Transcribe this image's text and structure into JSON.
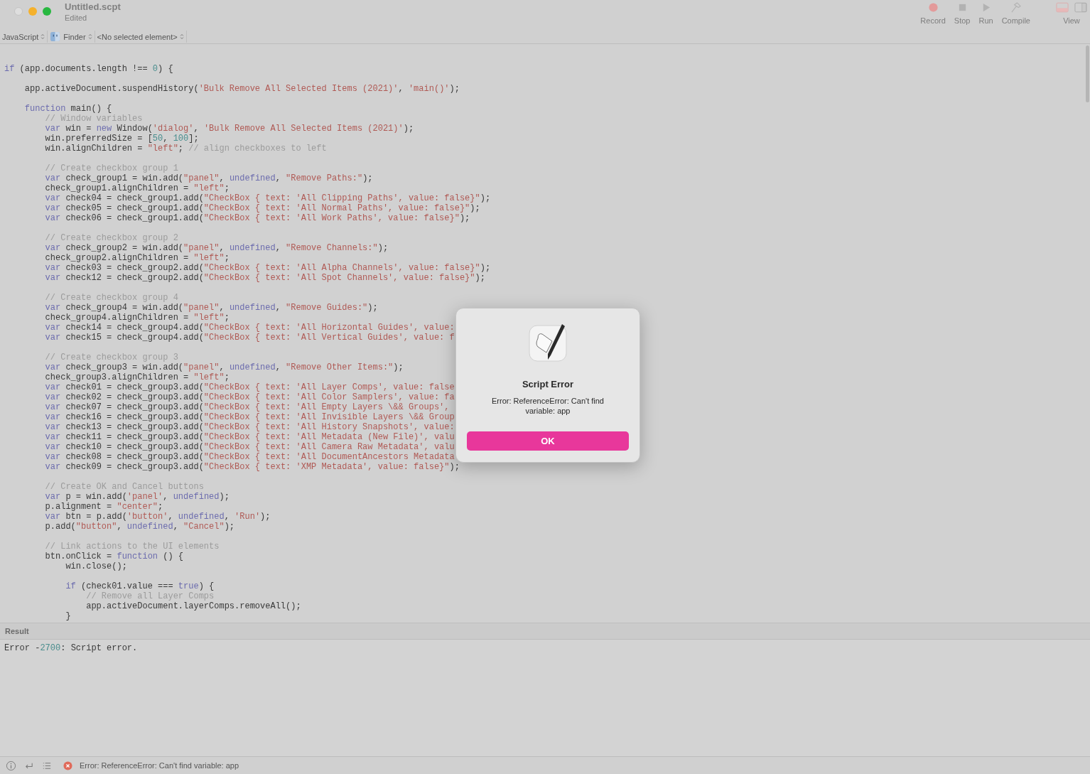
{
  "window": {
    "title": "Untitled.scpt",
    "subtitle": "Edited"
  },
  "toolbar": [
    {
      "label": "Record",
      "kind": "record"
    },
    {
      "label": "Stop",
      "kind": "stop"
    },
    {
      "label": "Run",
      "kind": "run"
    },
    {
      "label": "Compile",
      "kind": "compile"
    }
  ],
  "view": {
    "label": "View"
  },
  "navigation": [
    {
      "label": "JavaScript",
      "kind": "text"
    },
    {
      "label": "Finder",
      "kind": "app"
    },
    {
      "label": "<No selected element>",
      "kind": "text"
    }
  ],
  "editor": {
    "blocks": [
      [
        [
          {
            "kind": "keyword",
            "text": "if"
          },
          {
            "kind": "plain",
            "text": " (app.documents.length !== "
          },
          {
            "kind": "number",
            "text": "0"
          },
          {
            "kind": "plain",
            "text": ") {"
          }
        ]
      ],
      [
        [
          {
            "kind": "plain",
            "text": "    app.activeDocument.suspendHistory("
          },
          {
            "kind": "string",
            "text": "'Bulk Remove All Selected Items (2021)'"
          },
          {
            "kind": "plain",
            "text": ", "
          },
          {
            "kind": "string",
            "text": "'main()'"
          },
          {
            "kind": "plain",
            "text": ");"
          }
        ]
      ],
      [
        [
          {
            "kind": "keyword",
            "text": "    function"
          },
          {
            "kind": "plain",
            "text": " main() {"
          }
        ],
        [
          {
            "kind": "comment",
            "text": "        // Window variables"
          }
        ],
        [
          {
            "kind": "keyword",
            "text": "        var"
          },
          {
            "kind": "plain",
            "text": " win = "
          },
          {
            "kind": "keyword",
            "text": "new"
          },
          {
            "kind": "plain",
            "text": " Window("
          },
          {
            "kind": "string",
            "text": "'dialog'"
          },
          {
            "kind": "plain",
            "text": ", "
          },
          {
            "kind": "string",
            "text": "'Bulk Remove All Selected Items (2021)'"
          },
          {
            "kind": "plain",
            "text": ");"
          }
        ],
        [
          {
            "kind": "plain",
            "text": "        win.preferredSize = ["
          },
          {
            "kind": "number",
            "text": "50"
          },
          {
            "kind": "plain",
            "text": ", "
          },
          {
            "kind": "number",
            "text": "100"
          },
          {
            "kind": "plain",
            "text": "];"
          }
        ],
        [
          {
            "kind": "plain",
            "text": "        win.alignChildren = "
          },
          {
            "kind": "string",
            "text": "\"left\""
          },
          {
            "kind": "plain",
            "text": "; "
          },
          {
            "kind": "comment",
            "text": "// align checkboxes to left"
          }
        ]
      ],
      [
        [
          {
            "kind": "comment",
            "text": "        // Create checkbox group 1"
          }
        ],
        [
          {
            "kind": "keyword",
            "text": "        var"
          },
          {
            "kind": "plain",
            "text": " check_group1 = win.add("
          },
          {
            "kind": "string",
            "text": "\"panel\""
          },
          {
            "kind": "plain",
            "text": ", "
          },
          {
            "kind": "keyword",
            "text": "undefined"
          },
          {
            "kind": "plain",
            "text": ", "
          },
          {
            "kind": "string",
            "text": "\"Remove Paths:\""
          },
          {
            "kind": "plain",
            "text": ");"
          }
        ],
        [
          {
            "kind": "plain",
            "text": "        check_group1.alignChildren = "
          },
          {
            "kind": "string",
            "text": "\"left\""
          },
          {
            "kind": "plain",
            "text": ";"
          }
        ],
        [
          {
            "kind": "keyword",
            "text": "        var"
          },
          {
            "kind": "plain",
            "text": " check04 = check_group1.add("
          },
          {
            "kind": "string",
            "text": "\"CheckBox { text: 'All Clipping Paths', value: false}\""
          },
          {
            "kind": "plain",
            "text": ");"
          }
        ],
        [
          {
            "kind": "keyword",
            "text": "        var"
          },
          {
            "kind": "plain",
            "text": " check05 = check_group1.add("
          },
          {
            "kind": "string",
            "text": "\"CheckBox { text: 'All Normal Paths', value: false}\""
          },
          {
            "kind": "plain",
            "text": ");"
          }
        ],
        [
          {
            "kind": "keyword",
            "text": "        var"
          },
          {
            "kind": "plain",
            "text": " check06 = check_group1.add("
          },
          {
            "kind": "string",
            "text": "\"CheckBox { text: 'All Work Paths', value: false}\""
          },
          {
            "kind": "plain",
            "text": ");"
          }
        ]
      ],
      [
        [
          {
            "kind": "comment",
            "text": "        // Create checkbox group 2"
          }
        ],
        [
          {
            "kind": "keyword",
            "text": "        var"
          },
          {
            "kind": "plain",
            "text": " check_group2 = win.add("
          },
          {
            "kind": "string",
            "text": "\"panel\""
          },
          {
            "kind": "plain",
            "text": ", "
          },
          {
            "kind": "keyword",
            "text": "undefined"
          },
          {
            "kind": "plain",
            "text": ", "
          },
          {
            "kind": "string",
            "text": "\"Remove Channels:\""
          },
          {
            "kind": "plain",
            "text": ");"
          }
        ],
        [
          {
            "kind": "plain",
            "text": "        check_group2.alignChildren = "
          },
          {
            "kind": "string",
            "text": "\"left\""
          },
          {
            "kind": "plain",
            "text": ";"
          }
        ],
        [
          {
            "kind": "keyword",
            "text": "        var"
          },
          {
            "kind": "plain",
            "text": " check03 = check_group2.add("
          },
          {
            "kind": "string",
            "text": "\"CheckBox { text: 'All Alpha Channels', value: false}\""
          },
          {
            "kind": "plain",
            "text": ");"
          }
        ],
        [
          {
            "kind": "keyword",
            "text": "        var"
          },
          {
            "kind": "plain",
            "text": " check12 = check_group2.add("
          },
          {
            "kind": "string",
            "text": "\"CheckBox { text: 'All Spot Channels', value: false}\""
          },
          {
            "kind": "plain",
            "text": ");"
          }
        ]
      ],
      [
        [
          {
            "kind": "comment",
            "text": "        // Create checkbox group 4"
          }
        ],
        [
          {
            "kind": "keyword",
            "text": "        var"
          },
          {
            "kind": "plain",
            "text": " check_group4 = win.add("
          },
          {
            "kind": "string",
            "text": "\"panel\""
          },
          {
            "kind": "plain",
            "text": ", "
          },
          {
            "kind": "keyword",
            "text": "undefined"
          },
          {
            "kind": "plain",
            "text": ", "
          },
          {
            "kind": "string",
            "text": "\"Remove Guides:\""
          },
          {
            "kind": "plain",
            "text": ");"
          }
        ],
        [
          {
            "kind": "plain",
            "text": "        check_group4.alignChildren = "
          },
          {
            "kind": "string",
            "text": "\"left\""
          },
          {
            "kind": "plain",
            "text": ";"
          }
        ],
        [
          {
            "kind": "keyword",
            "text": "        var"
          },
          {
            "kind": "plain",
            "text": " check14 = check_group4.add("
          },
          {
            "kind": "string",
            "text": "\"CheckBox { text: 'All Horizontal Guides', value:"
          }
        ],
        [
          {
            "kind": "keyword",
            "text": "        var"
          },
          {
            "kind": "plain",
            "text": " check15 = check_group4.add("
          },
          {
            "kind": "string",
            "text": "\"CheckBox { text: 'All Vertical Guides', value: f"
          }
        ]
      ],
      [
        [
          {
            "kind": "comment",
            "text": "        // Create checkbox group 3"
          }
        ],
        [
          {
            "kind": "keyword",
            "text": "        var"
          },
          {
            "kind": "plain",
            "text": " check_group3 = win.add("
          },
          {
            "kind": "string",
            "text": "\"panel\""
          },
          {
            "kind": "plain",
            "text": ", "
          },
          {
            "kind": "keyword",
            "text": "undefined"
          },
          {
            "kind": "plain",
            "text": ", "
          },
          {
            "kind": "string",
            "text": "\"Remove Other Items:\""
          },
          {
            "kind": "plain",
            "text": ");"
          }
        ],
        [
          {
            "kind": "plain",
            "text": "        check_group3.alignChildren = "
          },
          {
            "kind": "string",
            "text": "\"left\""
          },
          {
            "kind": "plain",
            "text": ";"
          }
        ],
        [
          {
            "kind": "keyword",
            "text": "        var"
          },
          {
            "kind": "plain",
            "text": " check01 = check_group3.add("
          },
          {
            "kind": "string",
            "text": "\"CheckBox { text: 'All Layer Comps', value: false"
          }
        ],
        [
          {
            "kind": "keyword",
            "text": "        var"
          },
          {
            "kind": "plain",
            "text": " check02 = check_group3.add("
          },
          {
            "kind": "string",
            "text": "\"CheckBox { text: 'All Color Samplers', value: fa"
          }
        ],
        [
          {
            "kind": "keyword",
            "text": "        var"
          },
          {
            "kind": "plain",
            "text": " check07 = check_group3.add("
          },
          {
            "kind": "string",
            "text": "\"CheckBox { text: 'All Empty Layers \\&& Groups',"
          }
        ],
        [
          {
            "kind": "keyword",
            "text": "        var"
          },
          {
            "kind": "plain",
            "text": " check16 = check_group3.add("
          },
          {
            "kind": "string",
            "text": "\"CheckBox { text: 'All Invisible Layers \\&& Group"
          }
        ],
        [
          {
            "kind": "keyword",
            "text": "        var"
          },
          {
            "kind": "plain",
            "text": " check13 = check_group3.add("
          },
          {
            "kind": "string",
            "text": "\"CheckBox { text: 'All History Snapshots', value:"
          }
        ],
        [
          {
            "kind": "keyword",
            "text": "        var"
          },
          {
            "kind": "plain",
            "text": " check11 = check_group3.add("
          },
          {
            "kind": "string",
            "text": "\"CheckBox { text: 'All Metadata (New File)', valu"
          }
        ],
        [
          {
            "kind": "keyword",
            "text": "        var"
          },
          {
            "kind": "plain",
            "text": " check10 = check_group3.add("
          },
          {
            "kind": "string",
            "text": "\"CheckBox { text: 'All Camera Raw Metadata', valu"
          }
        ],
        [
          {
            "kind": "keyword",
            "text": "        var"
          },
          {
            "kind": "plain",
            "text": " check08 = check_group3.add("
          },
          {
            "kind": "string",
            "text": "\"CheckBox { text: 'All DocumentAncestors Metadata"
          }
        ],
        [
          {
            "kind": "keyword",
            "text": "        var"
          },
          {
            "kind": "plain",
            "text": " check09 = check_group3.add("
          },
          {
            "kind": "string",
            "text": "\"CheckBox { text: 'XMP Metadata', value: false}\""
          },
          {
            "kind": "plain",
            "text": ");"
          }
        ]
      ],
      [
        [
          {
            "kind": "comment",
            "text": "        // Create OK and Cancel buttons"
          }
        ],
        [
          {
            "kind": "keyword",
            "text": "        var"
          },
          {
            "kind": "plain",
            "text": " p = win.add("
          },
          {
            "kind": "string",
            "text": "'panel'"
          },
          {
            "kind": "plain",
            "text": ", "
          },
          {
            "kind": "keyword",
            "text": "undefined"
          },
          {
            "kind": "plain",
            "text": ");"
          }
        ],
        [
          {
            "kind": "plain",
            "text": "        p.alignment = "
          },
          {
            "kind": "string",
            "text": "\"center\""
          },
          {
            "kind": "plain",
            "text": ";"
          }
        ],
        [
          {
            "kind": "keyword",
            "text": "        var"
          },
          {
            "kind": "plain",
            "text": " btn = p.add("
          },
          {
            "kind": "string",
            "text": "'button'"
          },
          {
            "kind": "plain",
            "text": ", "
          },
          {
            "kind": "keyword",
            "text": "undefined"
          },
          {
            "kind": "plain",
            "text": ", "
          },
          {
            "kind": "string",
            "text": "'Run'"
          },
          {
            "kind": "plain",
            "text": ");"
          }
        ],
        [
          {
            "kind": "plain",
            "text": "        p.add("
          },
          {
            "kind": "string",
            "text": "\"button\""
          },
          {
            "kind": "plain",
            "text": ", "
          },
          {
            "kind": "keyword",
            "text": "undefined"
          },
          {
            "kind": "plain",
            "text": ", "
          },
          {
            "kind": "string",
            "text": "\"Cancel\""
          },
          {
            "kind": "plain",
            "text": ");"
          }
        ]
      ],
      [
        [
          {
            "kind": "comment",
            "text": "        // Link actions to the UI elements"
          }
        ],
        [
          {
            "kind": "plain",
            "text": "        btn.onClick = "
          },
          {
            "kind": "keyword",
            "text": "function"
          },
          {
            "kind": "plain",
            "text": " () {"
          }
        ],
        [
          {
            "kind": "plain",
            "text": "            win.close();"
          }
        ]
      ],
      [
        [
          {
            "kind": "keyword",
            "text": "            if"
          },
          {
            "kind": "plain",
            "text": " (check01.value === "
          },
          {
            "kind": "keyword",
            "text": "true"
          },
          {
            "kind": "plain",
            "text": ") {"
          }
        ],
        [
          {
            "kind": "comment",
            "text": "                // Remove all Layer Comps"
          }
        ],
        [
          {
            "kind": "plain",
            "text": "                app.activeDocument.layerComps.removeAll();"
          }
        ],
        [
          {
            "kind": "plain",
            "text": "            }"
          }
        ]
      ]
    ]
  },
  "result": {
    "title": "Result",
    "lines": [
      [
        {
          "kind": "plain",
          "text": "Error -"
        },
        {
          "kind": "number",
          "text": "2700"
        },
        {
          "kind": "plain",
          "text": ": Script error."
        }
      ]
    ]
  },
  "status_bar": {
    "message": "Error: ReferenceError: Can't find variable: app"
  },
  "dialog": {
    "title": "Script Error",
    "message": "Error: ReferenceError: Can't find variable: app",
    "button": "OK"
  }
}
